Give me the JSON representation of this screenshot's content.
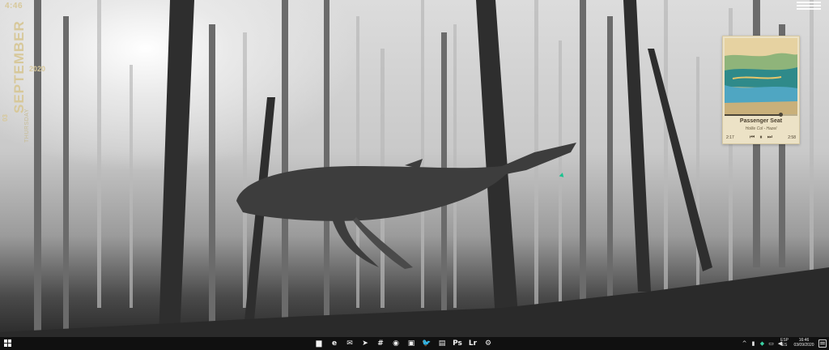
{
  "desktop": {
    "date_widget": {
      "time": "4:46",
      "month": "SEPTEMBER",
      "year": "2020",
      "day": "03",
      "weekday": "THURSDAY"
    },
    "music_player": {
      "title": "Passenger Seat",
      "artist": "Hollie Col - Hazel",
      "elapsed": "2:17",
      "total": "2:58",
      "progress": 0.77,
      "controls": [
        "prev-icon",
        "pause-icon",
        "next-icon"
      ]
    }
  },
  "taskbar": {
    "pinned_apps": [
      {
        "name": "file-explorer-icon",
        "glyph": "▆"
      },
      {
        "name": "edge-icon",
        "glyph": "e"
      },
      {
        "name": "mail-icon",
        "glyph": "✉"
      },
      {
        "name": "telegram-icon",
        "glyph": "➤"
      },
      {
        "name": "slack-icon",
        "glyph": "#"
      },
      {
        "name": "spotify-icon",
        "glyph": "◉"
      },
      {
        "name": "photos-icon",
        "glyph": "▣"
      },
      {
        "name": "twitter-icon",
        "glyph": "🐦"
      },
      {
        "name": "notes-icon",
        "glyph": "▤"
      },
      {
        "name": "photoshop-icon",
        "glyph": "Ps"
      },
      {
        "name": "lightroom-icon",
        "glyph": "Lr"
      },
      {
        "name": "steam-icon",
        "glyph": "⚙"
      }
    ],
    "tray": {
      "language": "ESP",
      "region": "ES",
      "time": "16:46",
      "date": "03/09/2020"
    },
    "colors": {
      "accent": "#3ad1a3",
      "taskbar_bg": "#101010"
    }
  }
}
